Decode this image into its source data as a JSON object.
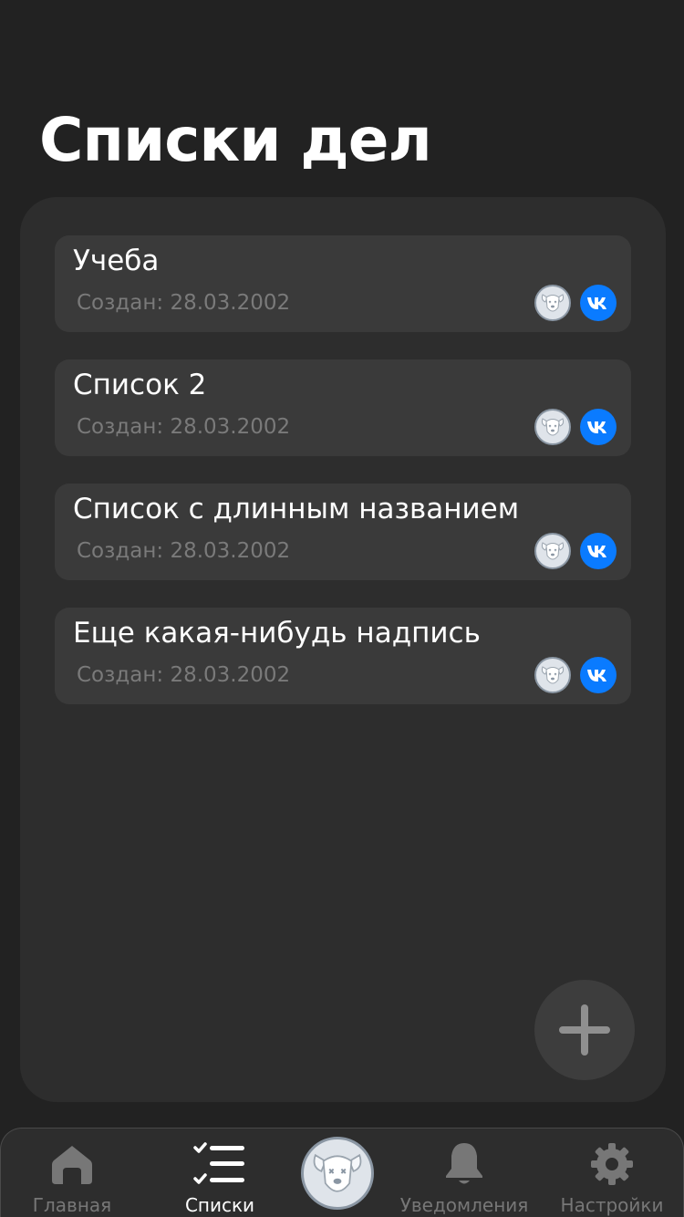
{
  "header": {
    "title": "Списки дел"
  },
  "lists": [
    {
      "title": "Учеба",
      "created": "Создан: 28.03.2002"
    },
    {
      "title": "Список 2",
      "created": "Создан: 28.03.2002"
    },
    {
      "title": "Список с длинным названием",
      "created": "Создан: 28.03.2002"
    },
    {
      "title": "Еще какая-нибудь надпись",
      "created": "Создан: 28.03.2002"
    }
  ],
  "fab": {
    "icon": "plus-icon"
  },
  "tabbar": {
    "tabs": [
      {
        "label": "Главная",
        "icon": "home-icon",
        "active": false
      },
      {
        "label": "Списки",
        "icon": "checklist-icon",
        "active": true
      },
      {
        "label": "",
        "icon": "profile-avatar",
        "active": false
      },
      {
        "label": "Уведомления",
        "icon": "bell-icon",
        "active": false
      },
      {
        "label": "Настройки",
        "icon": "gear-icon",
        "active": false
      }
    ]
  },
  "colors": {
    "background": "#222222",
    "panel": "#2d2d2d",
    "card": "#3a3a3a",
    "vk_blue": "#0a7bff",
    "muted_text": "#7a7a7a"
  }
}
